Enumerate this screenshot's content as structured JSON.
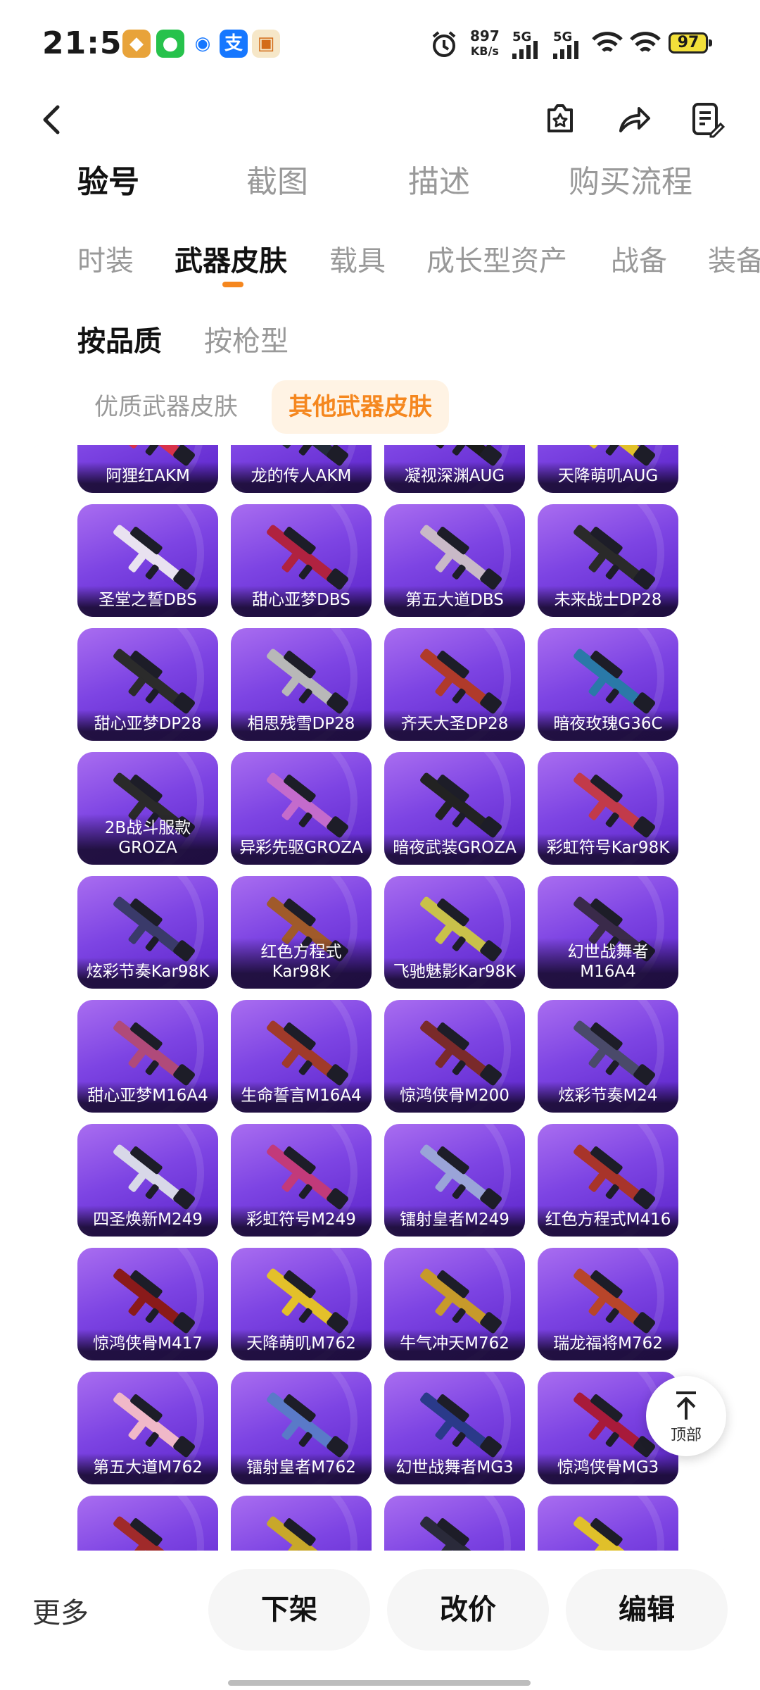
{
  "status_bar": {
    "time": "21:52",
    "speed_value": "897",
    "speed_unit": "KB/s",
    "net1": "5G",
    "net2": "5G",
    "battery": "97"
  },
  "primary_tabs": [
    "验号",
    "截图",
    "描述",
    "购买流程"
  ],
  "secondary_tabs": [
    "时装",
    "武器皮肤",
    "载具",
    "成长型资产",
    "战备",
    "装备"
  ],
  "tertiary_tabs": [
    "按品质",
    "按枪型"
  ],
  "chips": [
    "优质武器皮肤",
    "其他武器皮肤"
  ],
  "skins": [
    [
      "阿狸红AKM",
      "龙的传人AKM",
      "凝视深渊AUG",
      "天降萌叽AUG"
    ],
    [
      "圣堂之誓DBS",
      "甜心亚梦DBS",
      "第五大道DBS",
      "未来战士DP28"
    ],
    [
      "甜心亚梦DP28",
      "相思残雪DP28",
      "齐天大圣DP28",
      "暗夜玫瑰G36C"
    ],
    [
      "2B战斗服款\nGROZA",
      "异彩先驱GROZA",
      "暗夜武装GROZA",
      "彩虹符号Kar98K"
    ],
    [
      "炫彩节奏Kar98K",
      "红色方程式\nKar98K",
      "飞驰魅影Kar98K",
      "幻世战舞者\nM16A4"
    ],
    [
      "甜心亚梦M16A4",
      "生命誓言M16A4",
      "惊鸿侠骨M200",
      "炫彩节奏M24"
    ],
    [
      "四圣焕新M249",
      "彩虹符号M249",
      "镭射皇者M249",
      "红色方程式M416"
    ],
    [
      "惊鸿侠骨M417",
      "天降萌叽M762",
      "牛气冲天M762",
      "瑞龙福将M762"
    ],
    [
      "第五大道M762",
      "镭射皇者M762",
      "幻世战舞者MG3",
      "惊鸿侠骨MG3"
    ],
    [
      "",
      "",
      "",
      ""
    ]
  ],
  "to_top_label": "顶部",
  "bottom": {
    "more": "更多",
    "buttons": [
      "下架",
      "改价",
      "编辑"
    ]
  },
  "colors": {
    "accent": "#f5871f",
    "tile_top": "#a96df0",
    "tile_bottom": "#5a23c9"
  }
}
